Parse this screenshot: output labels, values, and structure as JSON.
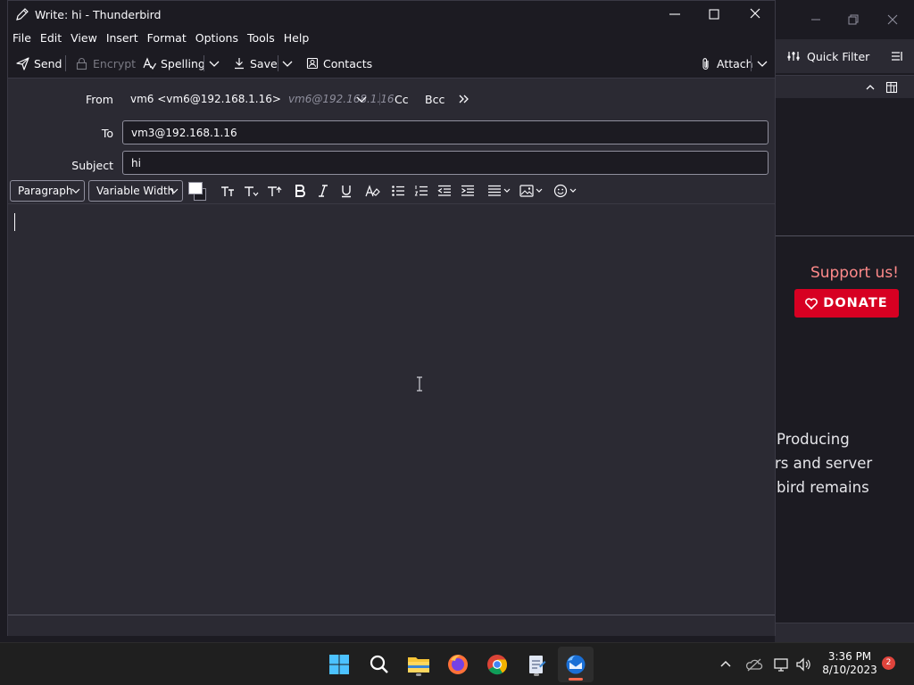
{
  "background_window": {
    "quick_filter_label": "Quick Filter",
    "support_text": "Support us!",
    "donate_label": "DONATE",
    "paragraph_lines": [
      "Producing",
      "rs and server",
      "bird remains"
    ]
  },
  "compose": {
    "window_title": "Write: hi - Thunderbird",
    "menu": [
      "File",
      "Edit",
      "View",
      "Insert",
      "Format",
      "Options",
      "Tools",
      "Help"
    ],
    "toolbar": {
      "send_label": "Send",
      "encrypt_label": "Encrypt",
      "spelling_label": "Spelling",
      "save_label": "Save",
      "contacts_label": "Contacts",
      "attach_label": "Attach"
    },
    "headers": {
      "from_label": "From",
      "from_identity": "vm6 <vm6@192.168.1.16>",
      "from_alias": "vm6@192.168.1.16",
      "cc_label": "Cc",
      "bcc_label": "Bcc",
      "to_label": "To",
      "to_value": "vm3@192.168.1.16",
      "subject_label": "Subject",
      "subject_value": "hi"
    },
    "format_bar": {
      "paragraph_format": "Paragraph",
      "font_family": "Variable Width"
    }
  },
  "taskbar": {
    "time": "3:36 PM",
    "date": "8/10/2023",
    "notification_count": "2"
  },
  "colors": {
    "accent_red": "#d70022",
    "window_bg": "#2b2a33",
    "titlebar_bg": "#1c1b22"
  }
}
